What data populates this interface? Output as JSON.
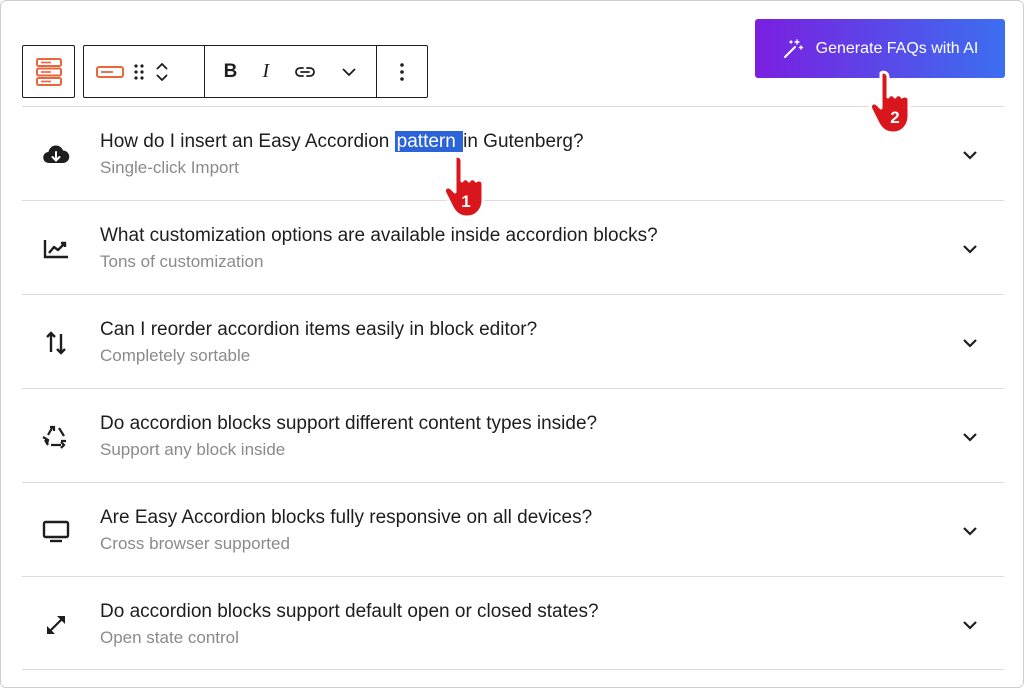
{
  "generate_button": {
    "label": "Generate FAQs with AI"
  },
  "faqs": [
    {
      "question_before": "How do I insert an Easy Accordion ",
      "question_highlight": "pattern ",
      "question_after": "in Gutenberg?",
      "subtitle": "Single-click Import",
      "icon": "cloud-download-icon"
    },
    {
      "question": "What customization options are available inside accordion blocks?",
      "subtitle": "Tons of customization",
      "icon": "chart-line-icon"
    },
    {
      "question": "Can I reorder accordion items easily in block editor?",
      "subtitle": "Completely sortable",
      "icon": "sort-arrows-icon"
    },
    {
      "question": "Do accordion blocks support different content types inside?",
      "subtitle": "Support any block inside",
      "icon": "recycle-icon"
    },
    {
      "question": "Are Easy Accordion blocks fully responsive on all devices?",
      "subtitle": "Cross browser supported",
      "icon": "monitor-icon"
    },
    {
      "question": "Do accordion blocks support default open or closed states?",
      "subtitle": "Open state control",
      "icon": "expand-arrows-icon"
    }
  ],
  "annotations": {
    "marker_1": "1",
    "marker_2": "2"
  },
  "colors": {
    "accent_start": "#7a1fe0",
    "accent_end": "#3b6ff0",
    "block_icon": "#e8663d",
    "highlight": "#2b63d9",
    "cursor": "#d8161b"
  }
}
